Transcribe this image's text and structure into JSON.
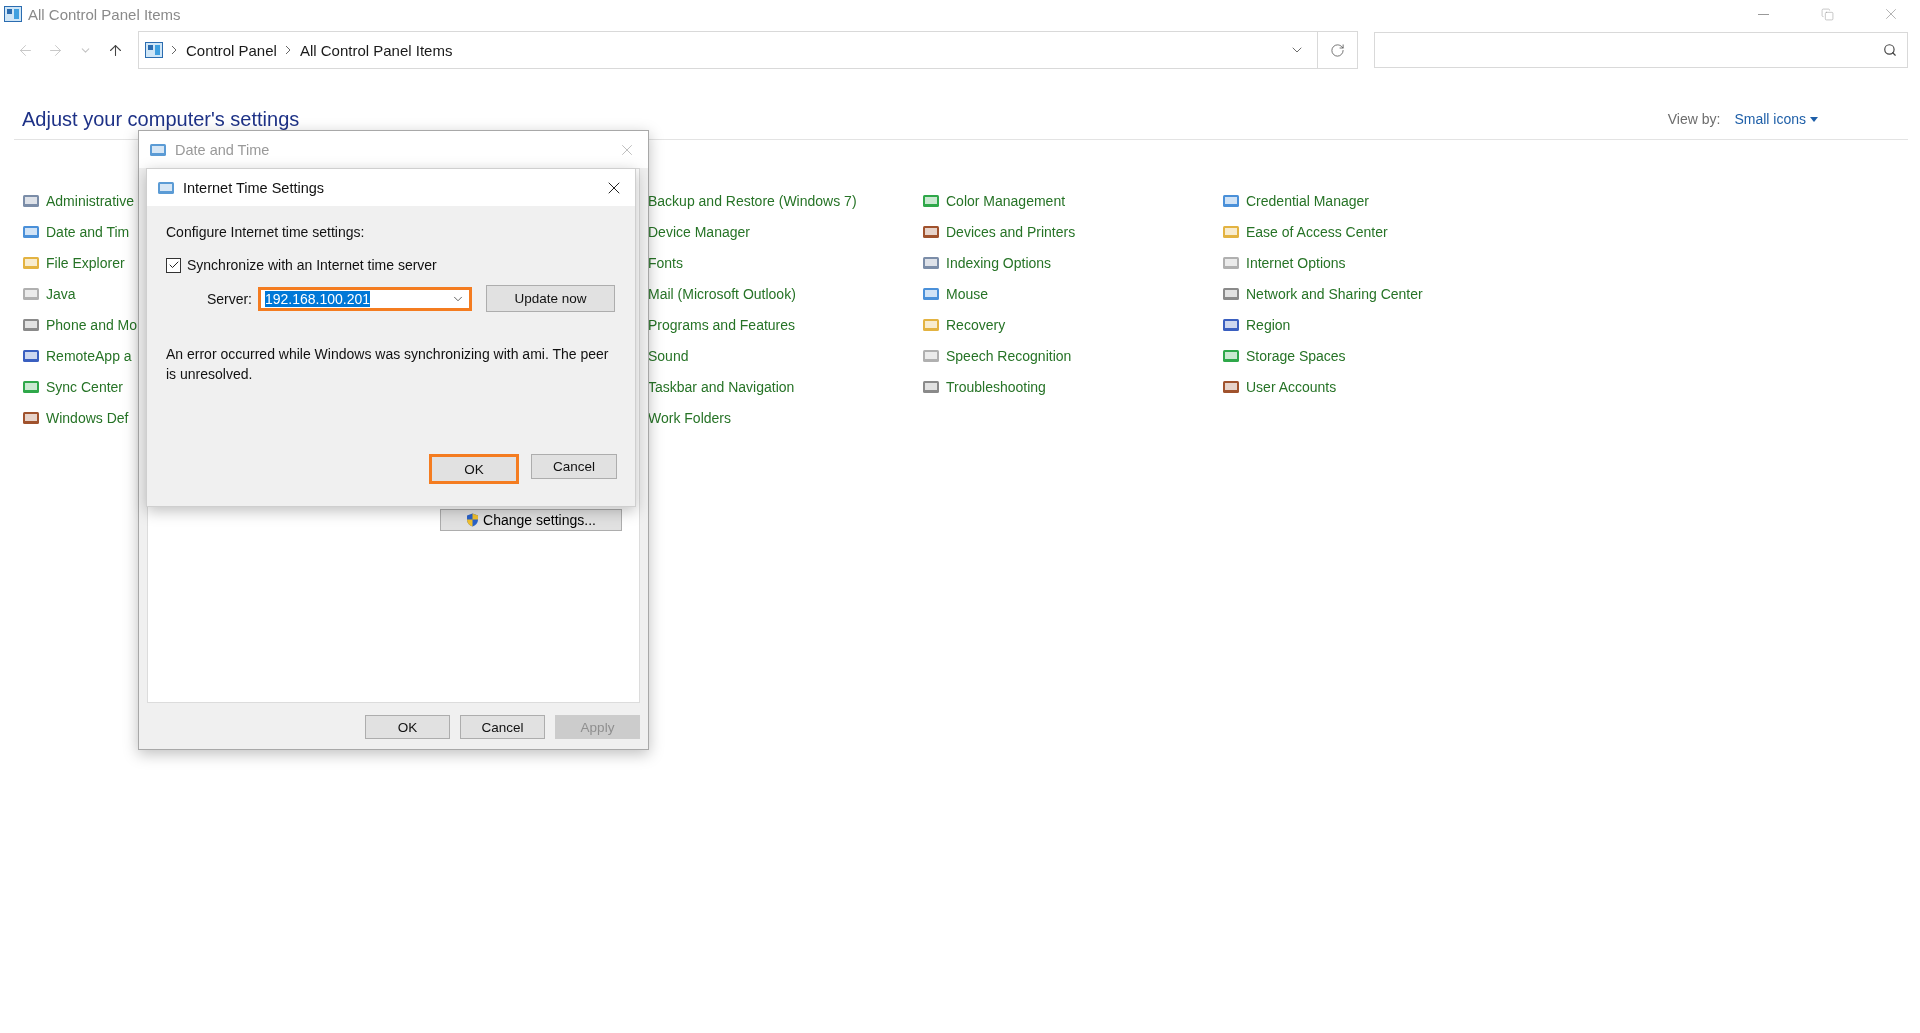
{
  "window": {
    "title": "All Control Panel Items"
  },
  "address_bar": {
    "breadcrumbs": [
      "Control Panel",
      "All Control Panel Items"
    ]
  },
  "heading": "Adjust your computer's settings",
  "view_by": {
    "label": "View by:",
    "value": "Small icons"
  },
  "columns": [
    {
      "show_icons": true,
      "items": [
        "Administrative",
        "Date and Tim",
        "File Explorer",
        "Java",
        "Phone and Mo",
        "RemoteApp a",
        "Sync Center",
        "Windows Def"
      ]
    },
    {
      "show_icons": false,
      "items": [
        "Backup and Restore (Windows 7)",
        "Device Manager",
        "Fonts",
        "Mail (Microsoft Outlook)",
        "Programs and Features",
        "Sound",
        "Taskbar and Navigation",
        "Work Folders"
      ]
    },
    {
      "show_icons": true,
      "items": [
        "Color Management",
        "Devices and Printers",
        "Indexing Options",
        "Mouse",
        "Recovery",
        "Speech Recognition",
        "Troubleshooting"
      ]
    },
    {
      "show_icons": true,
      "items": [
        "Credential Manager",
        "Ease of Access Center",
        "Internet Options",
        "Network and Sharing Center",
        "Region",
        "Storage Spaces",
        "User Accounts"
      ]
    }
  ],
  "date_time_dialog": {
    "title": "Date and Time",
    "change_settings": "Change settings...",
    "buttons": [
      {
        "label": "OK",
        "disabled": false
      },
      {
        "label": "Cancel",
        "disabled": false
      },
      {
        "label": "Apply",
        "disabled": true
      }
    ]
  },
  "internet_time_dialog": {
    "title": "Internet Time Settings",
    "heading": "Configure Internet time settings:",
    "sync": {
      "label": "Synchronize with an Internet time server",
      "checked": true
    },
    "server": {
      "label": "Server:",
      "value": "192.168.100.201",
      "text_selected": true,
      "highlighted": true
    },
    "update_button": "Update now",
    "message": "An error occurred while Windows was synchronizing with ami.  The peer is unresolved.",
    "buttons": [
      {
        "label": "OK",
        "highlighted": true
      },
      {
        "label": "Cancel",
        "highlighted": false
      }
    ]
  }
}
